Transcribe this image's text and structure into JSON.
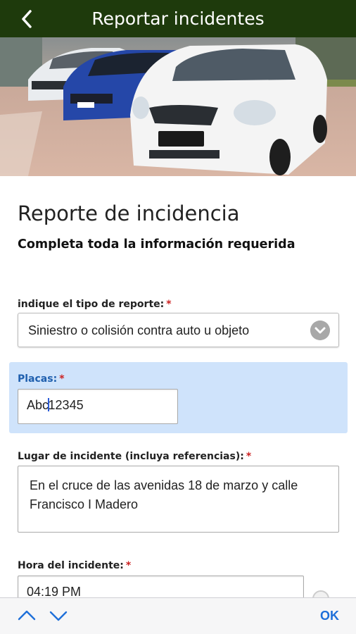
{
  "appbar": {
    "title": "Reportar incidentes",
    "back_icon": "back-arrow-icon",
    "color": "#1e3a0c"
  },
  "form": {
    "title": "Reporte de incidencia",
    "subtitle": "Completa toda la información requerida",
    "required_mark": "*",
    "report_type": {
      "label": "indique el tipo de reporte:",
      "value": "Siniestro o colisión contra auto u objeto"
    },
    "plates": {
      "label": "Placas:",
      "value_before_caret": "Abc",
      "value_after_caret": "12345"
    },
    "location": {
      "label": "Lugar de incidente (incluya referencias):",
      "value": "En el cruce de las avenidas 18 de marzo y calle Francisco I Madero"
    },
    "time": {
      "label": "Hora del incidente:",
      "value": "04:19 PM"
    }
  },
  "keyboard_bar": {
    "prev_icon": "chevron-up-icon",
    "next_icon": "chevron-down-icon",
    "done_label": "OK",
    "accent": "#1e6fd9"
  }
}
